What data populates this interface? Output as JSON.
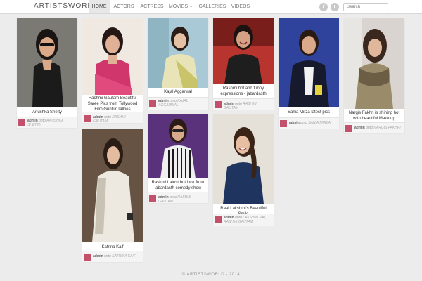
{
  "site": {
    "brand": "ARTISTSWORLD"
  },
  "nav": {
    "items": [
      {
        "label": "HOME"
      },
      {
        "label": "ACTORS"
      },
      {
        "label": "ACTRESS"
      },
      {
        "label": "MOVIES"
      },
      {
        "label": "GALLERIES"
      },
      {
        "label": "VIDEOS"
      }
    ],
    "active": "HOME"
  },
  "social": {
    "facebook": "f",
    "twitter": "t"
  },
  "search": {
    "placeholder": "Search"
  },
  "posts": [
    {
      "title": "Anushka Shetty",
      "author": "admin",
      "onto": "onto",
      "category": "ANUSHKA SHETTY"
    },
    {
      "title": "Rashmi Gautam Beautiful Saree Pics from Tollywood Film Guntur Talkies",
      "author": "admin",
      "onto": "onto",
      "category": "RASHMI GAUTAM"
    },
    {
      "title": "Kajal Aggarwal",
      "author": "admin",
      "onto": "onto",
      "category": "KAJAL AGGARWAL"
    },
    {
      "title": "Rashmi hot and funny expressions - jabardasth",
      "author": "admin",
      "onto": "onto",
      "category": "RASHMI GAUTAM"
    },
    {
      "title": "Sania Mirza latest pics",
      "author": "admin",
      "onto": "onto",
      "category": "SANIA MIRZA"
    },
    {
      "title": "Nargis Fakhri is shining hot with beautiful Make up",
      "author": "admin",
      "onto": "onto",
      "category": "NARGIS FAKHRI"
    },
    {
      "title": "Katrina Kaif",
      "author": "admin",
      "onto": "onto",
      "category": "KATRINA KAIF"
    },
    {
      "title": "Rashmi Latest hot look from jabardasth comedy show",
      "author": "admin",
      "onto": "onto",
      "category": "RASHMI GAUTAM"
    },
    {
      "title": "Raai Lakshmi's Beautiful Smile",
      "author": "admin",
      "onto": "onto",
      "category": "LAKSHMI RAI, RASHMI GAUTAM"
    }
  ],
  "footer": {
    "copyright": "© ARTISTSWORLD - 2014"
  },
  "colors": {
    "avatar": "#c2526b",
    "background": "#ececec",
    "nav_active": "#e7e7e7"
  }
}
